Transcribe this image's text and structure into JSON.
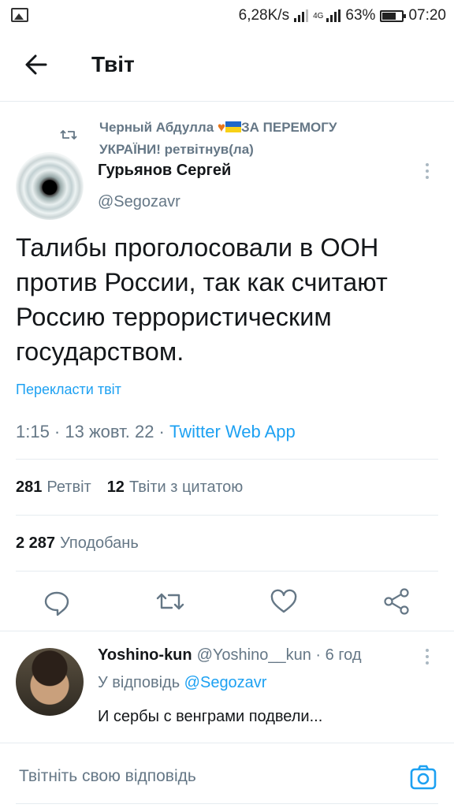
{
  "status_bar": {
    "speed": "6,28K/s",
    "network": "4G",
    "battery": "63%",
    "time": "07:20"
  },
  "header": {
    "title": "Твіт",
    "back_icon": "arrow-left-icon"
  },
  "tweet": {
    "retweeted_by": "Черный Абдулла",
    "retweeted_by_tail": "ЗА ПЕРЕМОГУ УКРАЇНИ! ретвітнув(ла)",
    "author_name": "Гурьянов Сергей",
    "author_handle": "@Segozavr",
    "text": "Талибы проголосовали в ООН против России, так как считают Россию террористическим государством.",
    "translate_label": "Перекласти твіт",
    "time": "1:15 · 13 жовт. 22 · ",
    "source": "Twitter Web App",
    "retweets_count": "281",
    "retweets_label": "Ретвіт",
    "quotes_count": "12",
    "quotes_label": "Твіти з цитатою",
    "likes_count": "2 287",
    "likes_label": "Уподобань"
  },
  "colors": {
    "accent": "#1da1f2",
    "muted": "#657786",
    "heart": "#e8761a",
    "flag_blue": "#1f68c8",
    "flag_yellow": "#f7d117"
  },
  "reply": {
    "name": "Yoshino-kun",
    "handle_time": "@Yoshino__kun · 6 год",
    "replying_prefix": "У відповідь ",
    "replying_to": "@Segozavr",
    "text": "И сербы с венграми подвели..."
  },
  "composer": {
    "placeholder": "Твітніть свою відповідь"
  }
}
